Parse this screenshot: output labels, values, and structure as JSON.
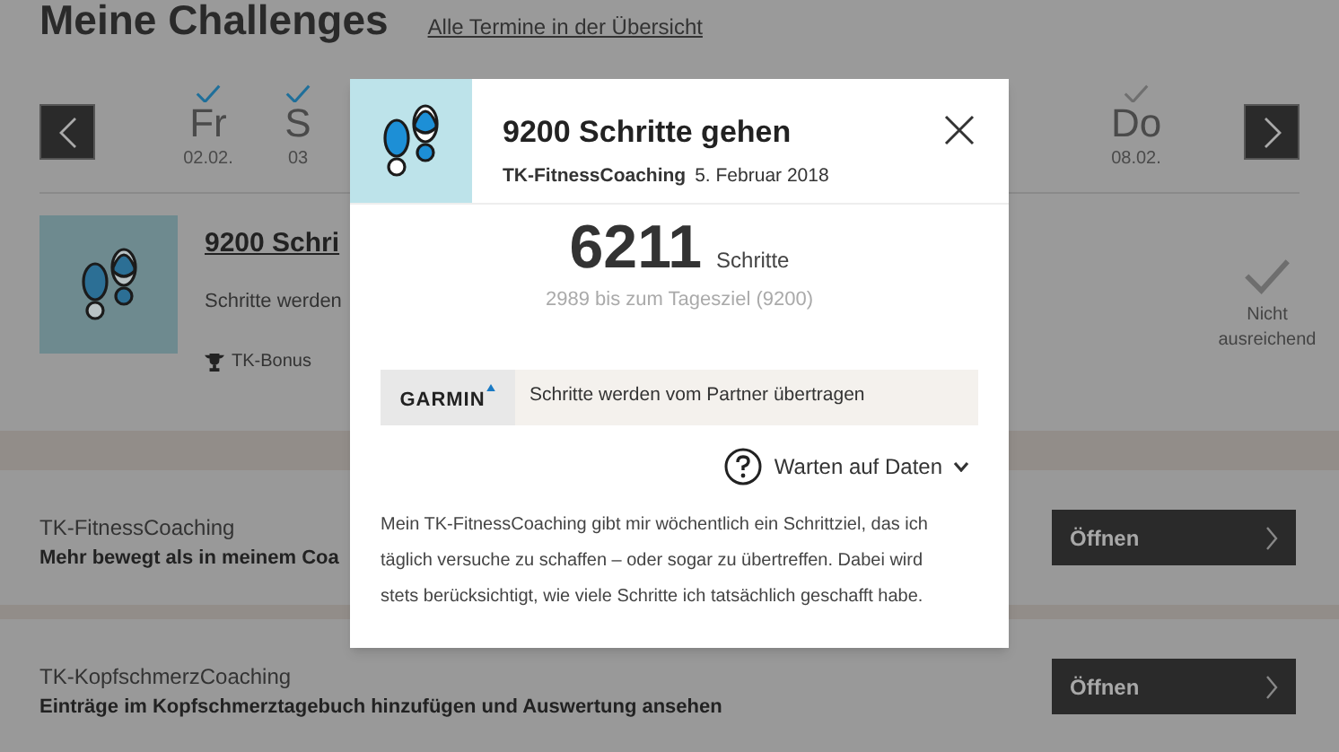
{
  "page": {
    "title": "Meine Challenges",
    "overview_link": "Alle Termine in der Übersicht"
  },
  "week": {
    "days": [
      {
        "name": "Fr",
        "date": "02.02.",
        "achieved": true
      },
      {
        "name": "S",
        "date": "03",
        "achieved": true
      },
      {
        "name": "Do",
        "date": "08.02.",
        "achieved": false
      }
    ]
  },
  "challenge": {
    "title": "9200 Schri",
    "description": "Schritte werden",
    "bonus": "TK-Bonus",
    "status": "Nicht ausreichend"
  },
  "coachings": [
    {
      "name": "TK-FitnessCoaching",
      "summary": "Mehr bewegt als in meinem Coa",
      "button": "Öffnen"
    },
    {
      "name": "TK-KopfschmerzCoaching",
      "summary": "Einträge im Kopfschmerztagebuch hinzufügen und Auswertung ansehen",
      "button": "Öffnen"
    }
  ],
  "modal": {
    "title": "9200 Schritte gehen",
    "program": "TK-FitnessCoaching",
    "date": "5. Februar 2018",
    "steps": "6211",
    "steps_unit": "Schritte",
    "remaining": "2989 bis zum Tagesziel (9200)",
    "partner": {
      "logo": "GARMIN",
      "note": "Schritte werden vom Partner übertragen"
    },
    "status": {
      "label": "Warten auf Daten",
      "expanded": false
    },
    "description": "Mein TK-FitnessCoaching gibt mir wöchentlich ein Schrittziel, das ich täglich versuche zu schaffen – oder sogar zu übertreffen. Dabei wird stets berücksichtigt, wie viele Schritte ich tatsächlich geschafft habe."
  }
}
